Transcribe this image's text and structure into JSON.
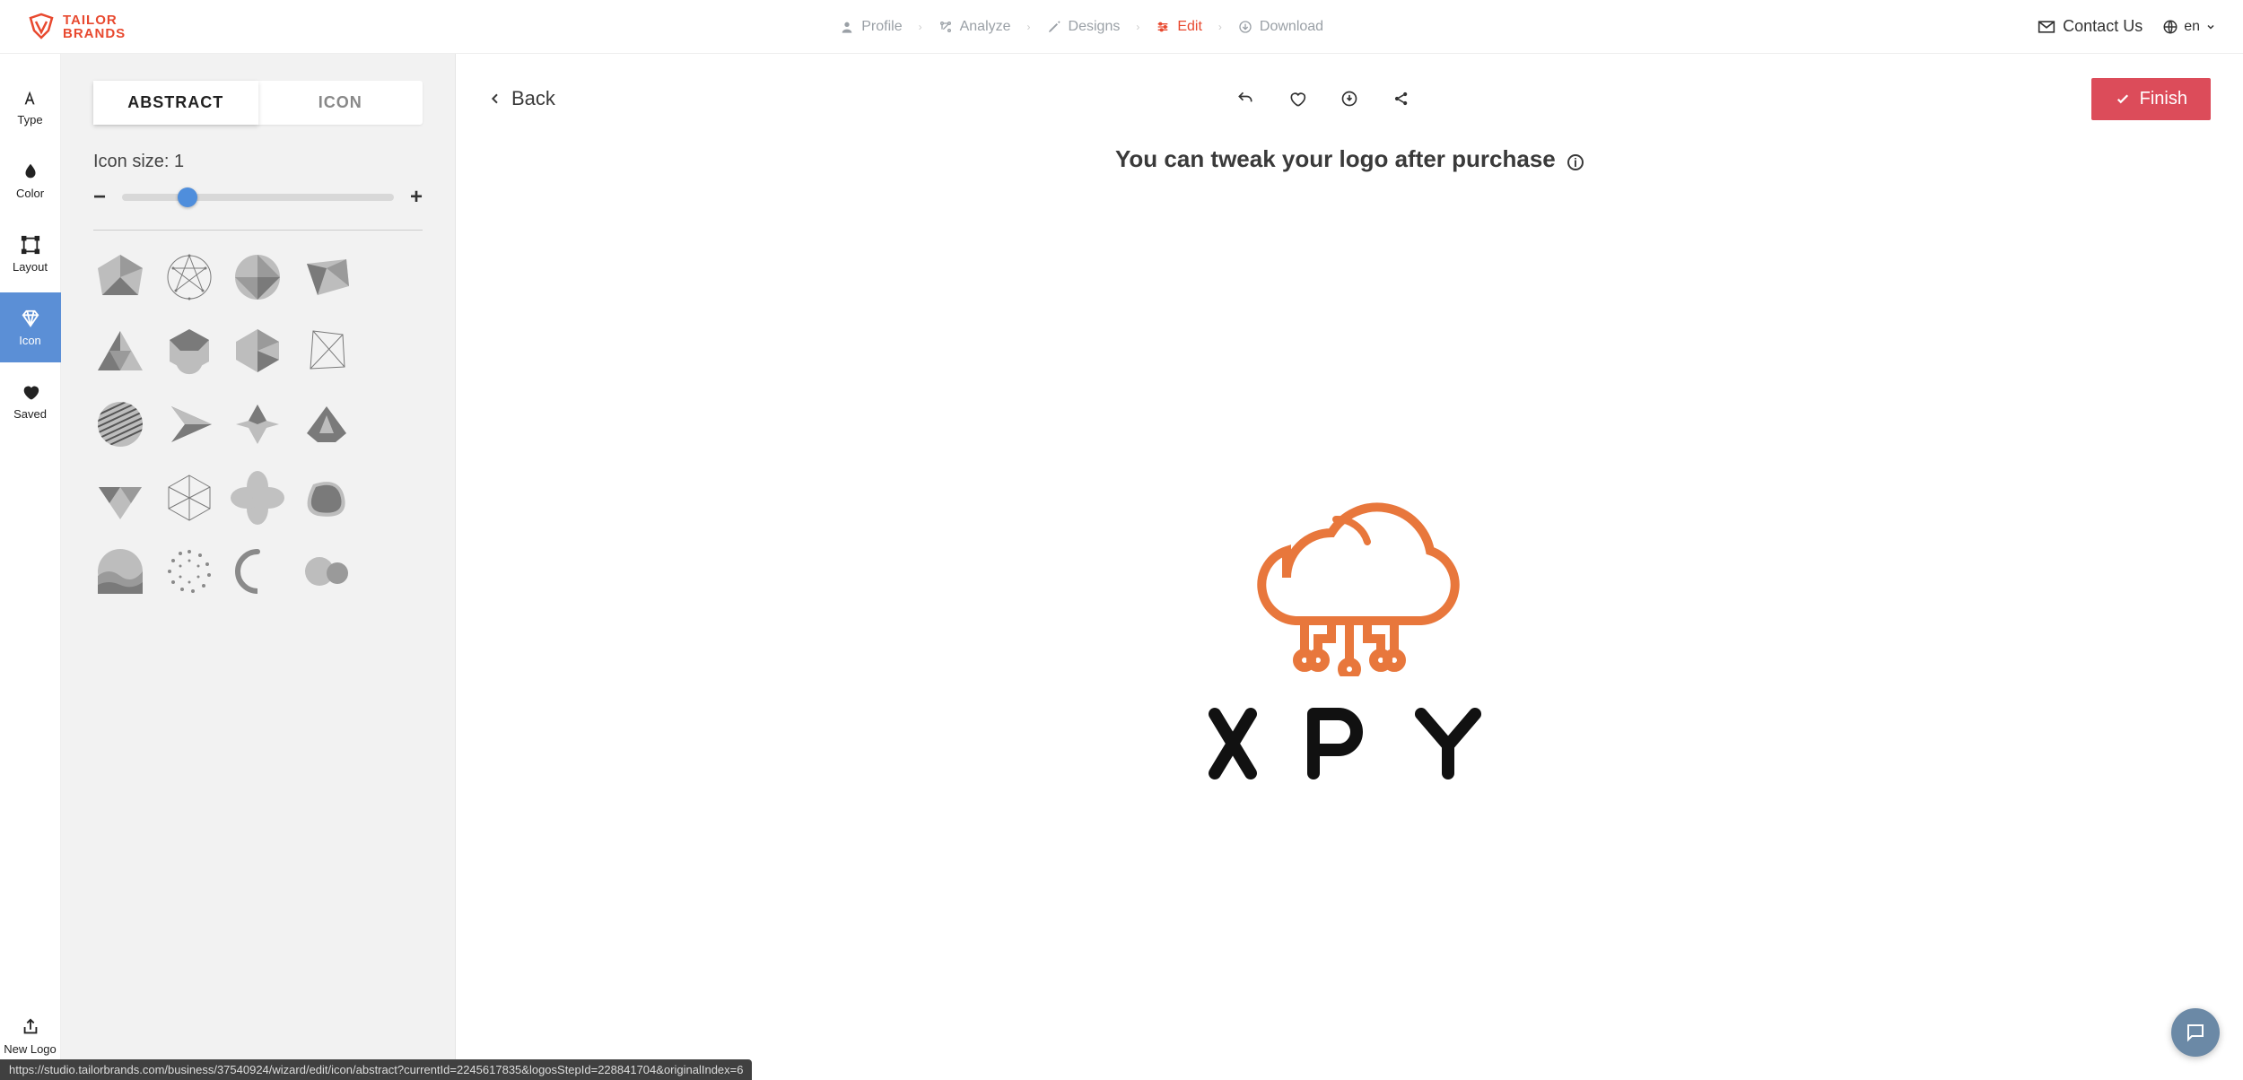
{
  "brand": {
    "line1": "TAILOR",
    "line2": "BRANDS",
    "color": "#e8492f"
  },
  "breadcrumbs": [
    {
      "label": "Profile",
      "icon": "user"
    },
    {
      "label": "Analyze",
      "icon": "analyze"
    },
    {
      "label": "Designs",
      "icon": "pencil"
    },
    {
      "label": "Edit",
      "icon": "sliders",
      "active": true
    },
    {
      "label": "Download",
      "icon": "download"
    }
  ],
  "header": {
    "contact_label": "Contact Us",
    "lang_label": "en"
  },
  "rail": {
    "items": [
      {
        "label": "Type",
        "icon": "type"
      },
      {
        "label": "Color",
        "icon": "drop"
      },
      {
        "label": "Layout",
        "icon": "layout"
      },
      {
        "label": "Icon",
        "icon": "diamond",
        "active": true
      },
      {
        "label": "Saved",
        "icon": "heart"
      }
    ],
    "bottom": {
      "label": "New Logo",
      "icon": "export"
    }
  },
  "panel": {
    "tabs": [
      {
        "label": "ABSTRACT",
        "active": true
      },
      {
        "label": "ICON"
      }
    ],
    "size_label_prefix": "Icon size: ",
    "size_value": "1",
    "slider_percent": 24
  },
  "canvas": {
    "back_label": "Back",
    "message": "You can tweak your logo after purchase",
    "finish_label": "Finish",
    "logo_text": "XPY",
    "logo_color": "#e8773c"
  },
  "status_url": "https://studio.tailorbrands.com/business/37540924/wizard/edit/icon/abstract?currentId=2245617835&logosStepId=228841704&originalIndex=6"
}
